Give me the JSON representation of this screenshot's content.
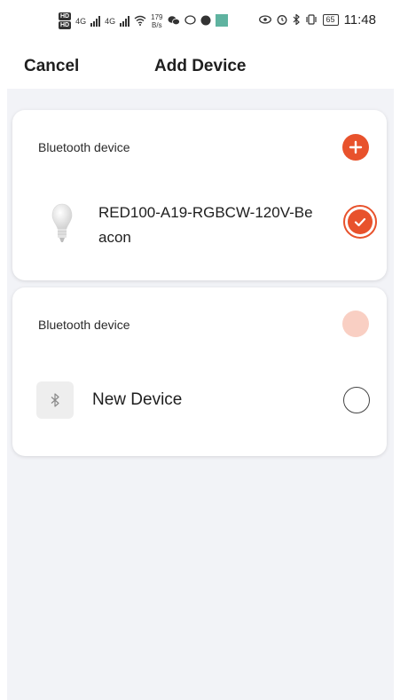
{
  "status_bar": {
    "network_speed_value": "179",
    "network_speed_unit": "B/s",
    "signal_label_1": "4G",
    "signal_label_2": "4G",
    "battery": "65",
    "time": "11:48"
  },
  "header": {
    "cancel_label": "Cancel",
    "title": "Add Device"
  },
  "cards": [
    {
      "label": "Bluetooth device",
      "device_name": "RED100-A19-RGBCW-120V-Beacon",
      "selected": true
    },
    {
      "label": "Bluetooth device",
      "device_name": "New Device",
      "selected": false
    }
  ],
  "colors": {
    "accent": "#e8522c",
    "accent_light": "#f9cfc3",
    "background": "#f2f3f7"
  },
  "icons": {
    "add": "plus-circle-icon",
    "check": "check-circle-icon",
    "bulb": "light-bulb-icon",
    "bluetooth": "bluetooth-icon"
  }
}
